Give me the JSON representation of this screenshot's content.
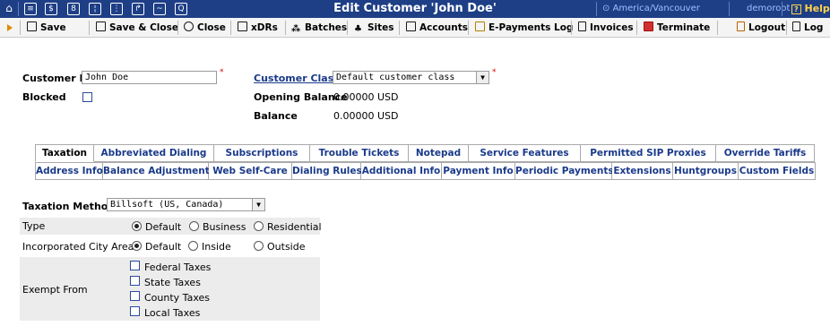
{
  "window": {
    "title": "Edit Customer 'John Doe'",
    "timezone": "America/Vancouver",
    "user": "demoroot",
    "help": "Help"
  },
  "toolbar": {
    "save": "Save",
    "save_close": "Save & Close",
    "close": "Close",
    "xdrs": "xDRs",
    "batches": "Batches",
    "sites": "Sites",
    "accounts": "Accounts",
    "epayments_log": "E-Payments Log",
    "invoices": "Invoices",
    "terminate": "Terminate",
    "logout": "Logout",
    "log": "Log"
  },
  "customer": {
    "id_label": "Customer ID",
    "id_value": "John Doe",
    "blocked_label": "Blocked",
    "class_label": "Customer Class",
    "class_value": "Default customer class",
    "opening_balance_label": "Opening Balance",
    "opening_balance_value": "0.00000 USD",
    "balance_label": "Balance",
    "balance_value": "0.00000 USD"
  },
  "tabs_row1": [
    "Taxation",
    "Abbreviated Dialing",
    "Subscriptions",
    "Trouble Tickets",
    "Notepad",
    "Service Features",
    "Permitted SIP Proxies",
    "Override Tariffs"
  ],
  "tabs_row2": [
    "Address Info",
    "Balance Adjustments",
    "Web Self-Care",
    "Dialing Rules",
    "Additional Info",
    "Payment Info",
    "Periodic Payments",
    "Extensions",
    "Huntgroups",
    "Custom Fields"
  ],
  "taxation": {
    "method_label": "Taxation Method",
    "method_value": "Billsoft (US, Canada)",
    "type_label": "Type",
    "type_options": [
      "Default",
      "Business",
      "Residential"
    ],
    "city_label": "Incorporated City Area",
    "city_options": [
      "Default",
      "Inside",
      "Outside"
    ],
    "exempt_label": "Exempt From",
    "exempt_options": [
      "Federal Taxes",
      "State Taxes",
      "County Taxes",
      "Local Taxes"
    ]
  }
}
